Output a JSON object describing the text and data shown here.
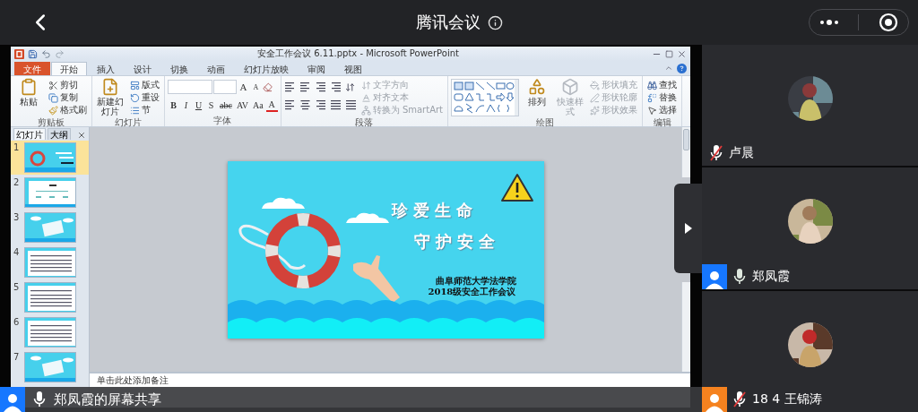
{
  "app_bar": {
    "title": "腾讯会议"
  },
  "powerpoint": {
    "title": "安全工作会议 6.11.pptx - Microsoft PowerPoint",
    "tabs": [
      {
        "label": "文件",
        "kind": "file",
        "selected": false
      },
      {
        "label": "开始",
        "kind": "tab",
        "selected": true
      },
      {
        "label": "插入",
        "kind": "tab",
        "selected": false
      },
      {
        "label": "设计",
        "kind": "tab",
        "selected": false
      },
      {
        "label": "切换",
        "kind": "tab",
        "selected": false
      },
      {
        "label": "动画",
        "kind": "tab",
        "selected": false
      },
      {
        "label": "幻灯片放映",
        "kind": "tab",
        "selected": false
      },
      {
        "label": "审阅",
        "kind": "tab",
        "selected": false
      },
      {
        "label": "视图",
        "kind": "tab",
        "selected": false
      }
    ],
    "ribbon": [
      {
        "label": "剪贴板",
        "kind": "standard",
        "big": [
          {
            "label": "粘贴",
            "disabled": false
          }
        ],
        "small": [
          {
            "label": "剪切",
            "disabled": false
          },
          {
            "label": "复制",
            "disabled": false
          },
          {
            "label": "格式刷",
            "disabled": false
          }
        ]
      },
      {
        "label": "幻灯片",
        "kind": "standard",
        "big": [
          {
            "label": "新建幻灯片",
            "disabled": false
          }
        ],
        "small": [
          {
            "label": "版式",
            "disabled": false
          },
          {
            "label": "重设",
            "disabled": false
          },
          {
            "label": "节",
            "disabled": false
          }
        ]
      },
      {
        "label": "字体",
        "kind": "font",
        "size_buttons": [
          "A",
          "A"
        ],
        "buttons": [
          "B",
          "I",
          "U",
          "S",
          "abc",
          "AV",
          "Aa",
          "A"
        ]
      },
      {
        "label": "段落",
        "kind": "paragraph",
        "small": [
          {
            "label": "文字方向",
            "disabled": true
          },
          {
            "label": "对齐文本",
            "disabled": true
          },
          {
            "label": "转换为 SmartArt",
            "disabled": true
          }
        ]
      },
      {
        "label": "绘图",
        "kind": "drawing",
        "big": [
          {
            "label": "排列",
            "disabled": false
          },
          {
            "label": "快速样式",
            "disabled": true
          }
        ],
        "small": [
          {
            "label": "形状填充",
            "disabled": true
          },
          {
            "label": "形状轮廓",
            "disabled": true
          },
          {
            "label": "形状效果",
            "disabled": true
          }
        ]
      },
      {
        "label": "编辑",
        "kind": "standard",
        "small": [
          {
            "label": "查找",
            "disabled": false
          },
          {
            "label": "替换",
            "disabled": false
          },
          {
            "label": "选择",
            "disabled": false
          }
        ]
      }
    ],
    "pane_tabs": [
      {
        "label": "幻灯片",
        "selected": true
      },
      {
        "label": "大纲",
        "selected": false
      }
    ],
    "slides": [
      {
        "number": "1",
        "kind": "title",
        "selected": true
      },
      {
        "number": "2",
        "kind": "chart",
        "selected": false
      },
      {
        "number": "3",
        "kind": "sign",
        "selected": false
      },
      {
        "number": "4",
        "kind": "text",
        "selected": false
      },
      {
        "number": "5",
        "kind": "text",
        "selected": false
      },
      {
        "number": "6",
        "kind": "text",
        "selected": false
      },
      {
        "number": "7",
        "kind": "sign",
        "selected": false
      }
    ],
    "current_slide": {
      "title_lines": [
        "珍爱生命",
        "守护安全"
      ],
      "subtitle_lines": [
        "曲阜师范大学法学院",
        "2018级安全工作会议"
      ]
    },
    "notes": {
      "placeholder": "单击此处添加备注"
    }
  },
  "share_bar": {
    "label": "郑凤霞的屏幕共享",
    "color": "#1677ff"
  },
  "participants": [
    {
      "name": "卢晨",
      "muted": true
    },
    {
      "name": "郑凤霞",
      "muted": false,
      "color": "#1677ff"
    },
    {
      "name": "18 4 王锦涛",
      "muted": true,
      "color": "#f5821f"
    }
  ]
}
